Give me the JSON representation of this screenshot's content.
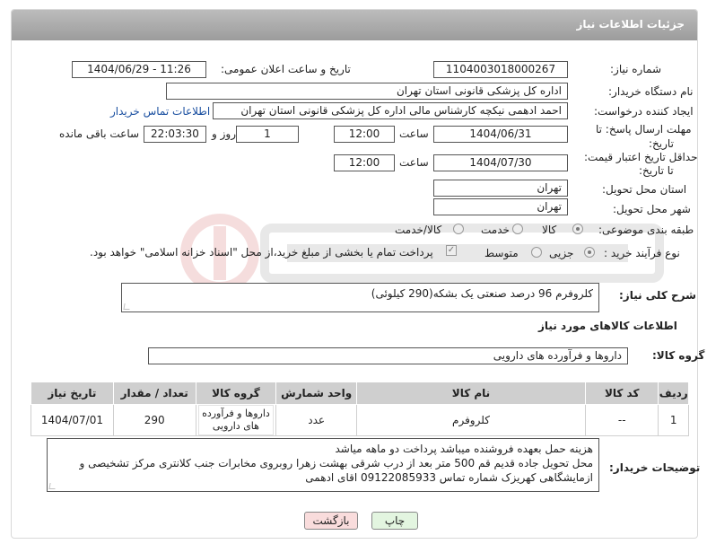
{
  "header": {
    "title": "جزئیات اطلاعات نیاز"
  },
  "fields": {
    "need_number_label": "شماره نیاز:",
    "need_number": "1104003018000267",
    "announce_label": "تاریخ و ساعت اعلان عمومی:",
    "announce_value": "1404/06/29 - 11:26",
    "buyer_org_label": "نام دستگاه خریدار:",
    "buyer_org": "اداره کل پزشکی قانونی استان تهران",
    "creator_label": "ایجاد کننده درخواست:",
    "creator": "احمد ادهمی نیکچه کارشناس مالی اداره کل پزشکی قانونی استان تهران",
    "contact_link": "اطلاعات تماس خریدار",
    "deadline_label_1": "مهلت ارسال پاسخ: تا",
    "deadline_label_2": "تاریخ:",
    "deadline_date": "1404/06/31",
    "time_label": "ساعت",
    "deadline_time": "12:00",
    "days_value": "1",
    "days_label": "روز و",
    "remaining_time": "22:03:30",
    "remaining_label": "ساعت باقی مانده",
    "price_label_1": "حداقل تاریخ اعتبار قیمت:",
    "price_label_2": "تا تاریخ:",
    "price_date": "1404/07/30",
    "price_time": "12:00",
    "province_label": "استان محل تحویل:",
    "province": "تهران",
    "city_label": "شهر محل تحویل:",
    "city": "تهران",
    "category_label": "طبقه بندی موضوعی:",
    "category_options": [
      "کالا",
      "خدمت",
      "کالا/خدمت"
    ],
    "process_label": "نوع فرآیند خرید :",
    "process_options": [
      "جزیی",
      "متوسط"
    ],
    "payment_note": "پرداخت تمام یا بخشی از مبلغ خرید،از محل \"اسناد خزانه اسلامی\" خواهد بود."
  },
  "description": {
    "label": "شرح کلی نیاز:",
    "value": "کلروفرم 96 درصد صنعتی یک بشکه(290 کیلوئی)"
  },
  "goods_section_title": "اطلاعات کالاهای مورد نیاز",
  "goods_group": {
    "label": "گروه کالا:",
    "value": "داروها و فرآورده های دارویی"
  },
  "table": {
    "headers": [
      "ردیف",
      "کد کالا",
      "نام کالا",
      "واحد شمارش",
      "گروه کالا",
      "تعداد / مقدار",
      "تاریخ نیاز"
    ],
    "rows": [
      [
        "1",
        "--",
        "کلروفرم",
        "عدد",
        "داروها و فرآورده های دارویی",
        "290",
        "1404/07/01"
      ]
    ]
  },
  "buyer_notes": {
    "label": "توضیحات خریدار:",
    "lines": [
      "هزینه حمل بعهده فروشنده میباشد پرداخت دو ماهه میاشد",
      "محل تحویل جاده قدیم قم 500 متر بعد از درب شرقی بهشت زهرا روبروی مخابرات جنب کلانتری مرکز تشخیصی و",
      "ازمایشگاهی کهریزک شماره تماس 09122085933 اقای ادهمی"
    ]
  },
  "buttons": {
    "print": "چاپ",
    "back": "بازگشت"
  },
  "colors": {
    "header_bg": "#a9a9a9",
    "link": "#1a4fa0",
    "back_button": "#f9dcdc",
    "print_button": "#e3f5e0"
  }
}
